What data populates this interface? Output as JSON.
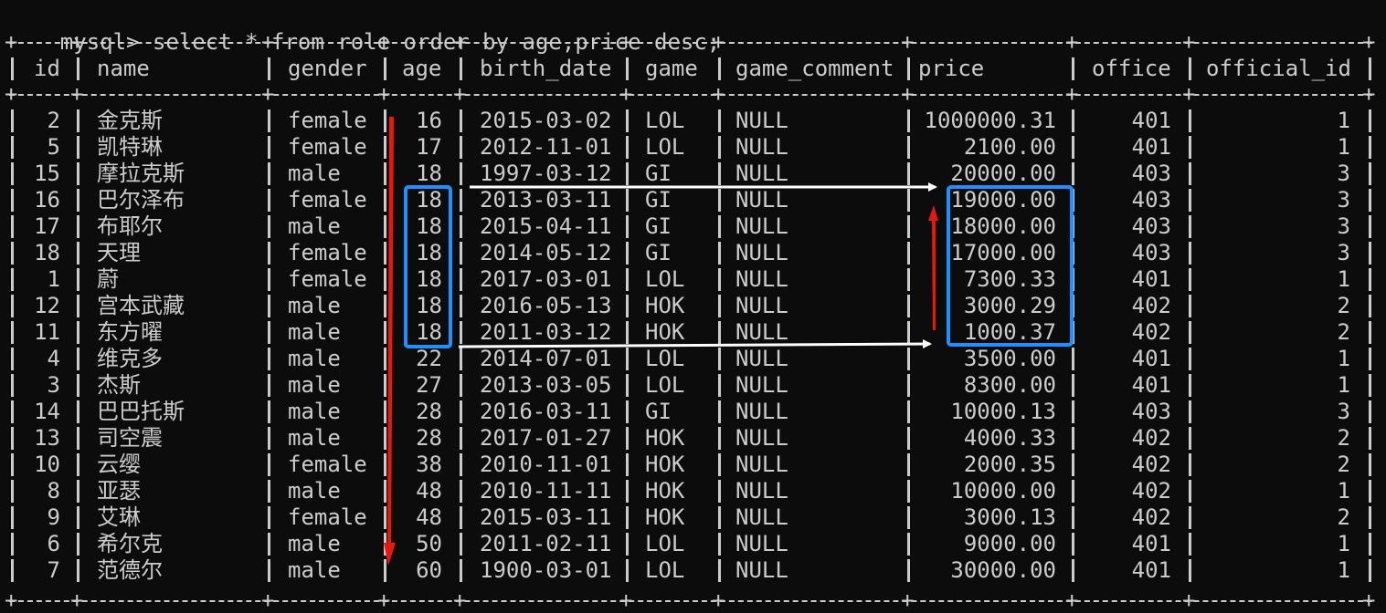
{
  "terminal": {
    "prompt": "mysql>",
    "command": "select * from role order by age,price desc;"
  },
  "table": {
    "headers": [
      "id",
      "name",
      "gender",
      "age",
      "birth_date",
      "game",
      "game_comment",
      "price",
      "office",
      "official_id"
    ],
    "rows": [
      [
        "2",
        "金克斯",
        "female",
        "16",
        "2015-03-02",
        "LOL",
        "NULL",
        "1000000.31",
        "401",
        "1"
      ],
      [
        "5",
        "凯特琳",
        "female",
        "17",
        "2012-11-01",
        "LOL",
        "NULL",
        "2100.00",
        "401",
        "1"
      ],
      [
        "15",
        "摩拉克斯",
        "male",
        "18",
        "1997-03-12",
        "GI",
        "NULL",
        "20000.00",
        "403",
        "3"
      ],
      [
        "16",
        "巴尔泽布",
        "female",
        "18",
        "2013-03-11",
        "GI",
        "NULL",
        "19000.00",
        "403",
        "3"
      ],
      [
        "17",
        "布耶尔",
        "male",
        "18",
        "2015-04-11",
        "GI",
        "NULL",
        "18000.00",
        "403",
        "3"
      ],
      [
        "18",
        "天理",
        "female",
        "18",
        "2014-05-12",
        "GI",
        "NULL",
        "17000.00",
        "403",
        "3"
      ],
      [
        "1",
        "蔚",
        "female",
        "18",
        "2017-03-01",
        "LOL",
        "NULL",
        "7300.33",
        "401",
        "1"
      ],
      [
        "12",
        "宫本武藏",
        "male",
        "18",
        "2016-05-13",
        "HOK",
        "NULL",
        "3000.29",
        "402",
        "2"
      ],
      [
        "11",
        "东方曜",
        "male",
        "18",
        "2011-03-12",
        "HOK",
        "NULL",
        "1000.37",
        "402",
        "2"
      ],
      [
        "4",
        "维克多",
        "male",
        "22",
        "2014-07-01",
        "LOL",
        "NULL",
        "3500.00",
        "401",
        "1"
      ],
      [
        "3",
        "杰斯",
        "male",
        "27",
        "2013-03-05",
        "LOL",
        "NULL",
        "8300.00",
        "401",
        "1"
      ],
      [
        "14",
        "巴巴托斯",
        "male",
        "28",
        "2016-03-11",
        "GI",
        "NULL",
        "10000.13",
        "403",
        "3"
      ],
      [
        "13",
        "司空震",
        "male",
        "28",
        "2017-01-27",
        "HOK",
        "NULL",
        "4000.33",
        "402",
        "2"
      ],
      [
        "10",
        "云缨",
        "female",
        "38",
        "2010-11-01",
        "HOK",
        "NULL",
        "2000.35",
        "402",
        "2"
      ],
      [
        "8",
        "亚瑟",
        "male",
        "48",
        "2010-11-11",
        "HOK",
        "NULL",
        "10000.00",
        "402",
        "1"
      ],
      [
        "9",
        "艾琳",
        "female",
        "48",
        "2015-03-11",
        "HOK",
        "NULL",
        "3000.13",
        "402",
        "2"
      ],
      [
        "6",
        "希尔克",
        "male",
        "50",
        "2011-02-11",
        "LOL",
        "NULL",
        "9000.00",
        "401",
        "1"
      ],
      [
        "7",
        "范德尔",
        "male",
        "60",
        "1900-03-01",
        "LOL",
        "NULL",
        "30000.00",
        "401",
        "1"
      ]
    ]
  },
  "colors": {
    "background": "#0c0c0c",
    "text": "#cccccc",
    "annotation_red": "#e8170f",
    "annotation_blue": "#1e90ff",
    "annotation_white": "#ffffff"
  }
}
